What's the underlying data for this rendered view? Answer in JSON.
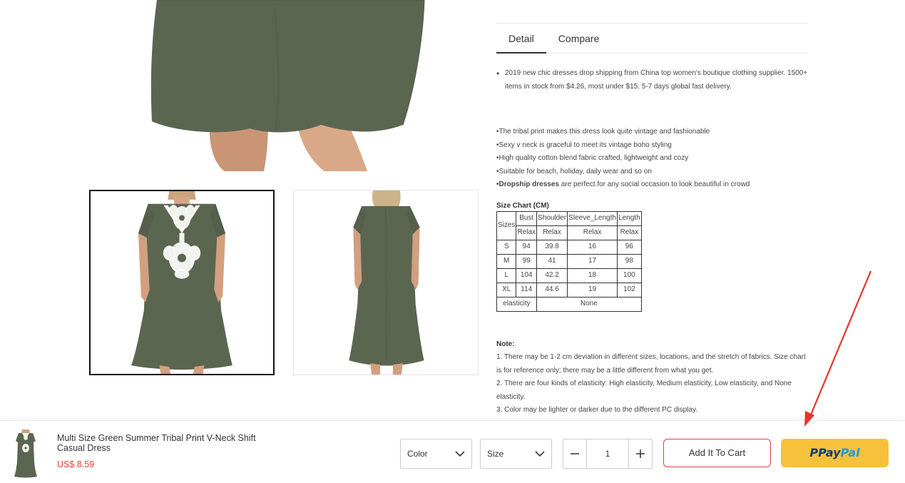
{
  "tabs": [
    {
      "label": "Detail"
    },
    {
      "label": "Compare"
    }
  ],
  "description": {
    "intro": "2019 new chic dresses drop shipping from China top women's boutique clothing supplier. 1500+ items in stock from $4.26, most under $15. 5-7 days global fast delivery.",
    "features": [
      "•The tribal print makes this dress look quite vintage and fashionable",
      "•Sexy v neck is graceful to meet its vintage boho styling",
      "•High quality cotton blend fabric crafted, lightweight and cozy",
      "•Suitable for beach, holiday, daily wear and so on"
    ],
    "feature_last_bold": "•Dropship dresses",
    "feature_last_rest": " are perfect for any social occasion to look beautiful in crowd"
  },
  "size_chart": {
    "title": "Size Chart (CM)",
    "sizes_label": "Sizes",
    "headers": [
      "Bust",
      "Shoulder",
      "Sleeve_Length",
      "Length"
    ],
    "sub": [
      "Relax",
      "Relax",
      "Relax",
      "Relax"
    ],
    "rows": [
      [
        "S",
        "94",
        "39.8",
        "16",
        "96"
      ],
      [
        "M",
        "99",
        "41",
        "17",
        "98"
      ],
      [
        "L",
        "104",
        "42.2",
        "18",
        "100"
      ],
      [
        "XL",
        "114",
        "44.6",
        "19",
        "102"
      ]
    ],
    "elasticity_label": "elasticity",
    "elasticity_value": "None"
  },
  "note": {
    "title": "Note:",
    "lines": [
      "1. There may be 1-2 cm deviation in different sizes, locations, and the stretch of fabrics. Size chart is for reference only; there may be a little different from what you get.",
      "2. There are four kinds of elasticity: High elasticity, Medium elasticity, Low elasticity, and None elasticity.",
      "3. Color may be lighter or darker due to the different PC display."
    ]
  },
  "bar": {
    "title": "Multi Size Green Summer Tribal Print V-Neck Shift Casual Dress",
    "price": "US$ 8.59",
    "color_label": "Color",
    "size_label": "Size",
    "qty": "1",
    "add_to_cart": "Add It To Cart",
    "paypal_pay": "Pay",
    "paypal_pal": "Pal"
  },
  "colors": {
    "dress": "#5b6651",
    "price": "#e2403a",
    "paypal_bg": "#f7c23b",
    "arrow": "#e8342c"
  }
}
